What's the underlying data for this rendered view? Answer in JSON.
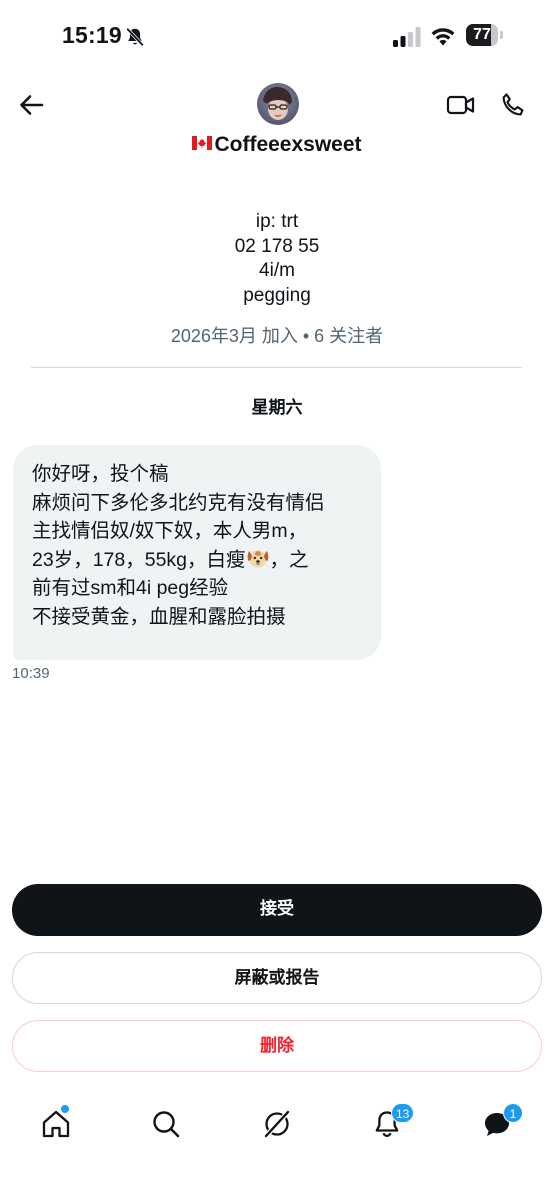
{
  "status_bar": {
    "time": "15:19",
    "battery": "77",
    "battery_level": 0.77
  },
  "header": {
    "display_name": "Coffeeexsweet",
    "bio_lines": [
      "ip: trt",
      "02 178 55",
      "4i/m",
      "pegging"
    ],
    "meta": "2026年3月 加入 • 6 关注者"
  },
  "conversation": {
    "day_label": "星期六",
    "message": {
      "lines": [
        "你好呀，投个稿",
        "麻烦问下多伦多北约克有没有情侣",
        "主找情侣奴/奴下奴，本人男m，",
        "23岁，178，55kg，白瘦",
        "，之",
        "前有过sm和4i peg经验",
        "不接受黄金，血腥和露脸拍摄"
      ],
      "time": "10:39"
    }
  },
  "actions": {
    "accept_label": "接受",
    "block_label": "屏蔽或报告",
    "delete_label": "删除"
  },
  "bottom_nav": {
    "notifications_badge": "13",
    "messages_badge": "1"
  },
  "colors": {
    "accent": "#1d9bf0",
    "danger": "#f4212e",
    "bubble": "#eff3f4",
    "muted": "#536471"
  }
}
